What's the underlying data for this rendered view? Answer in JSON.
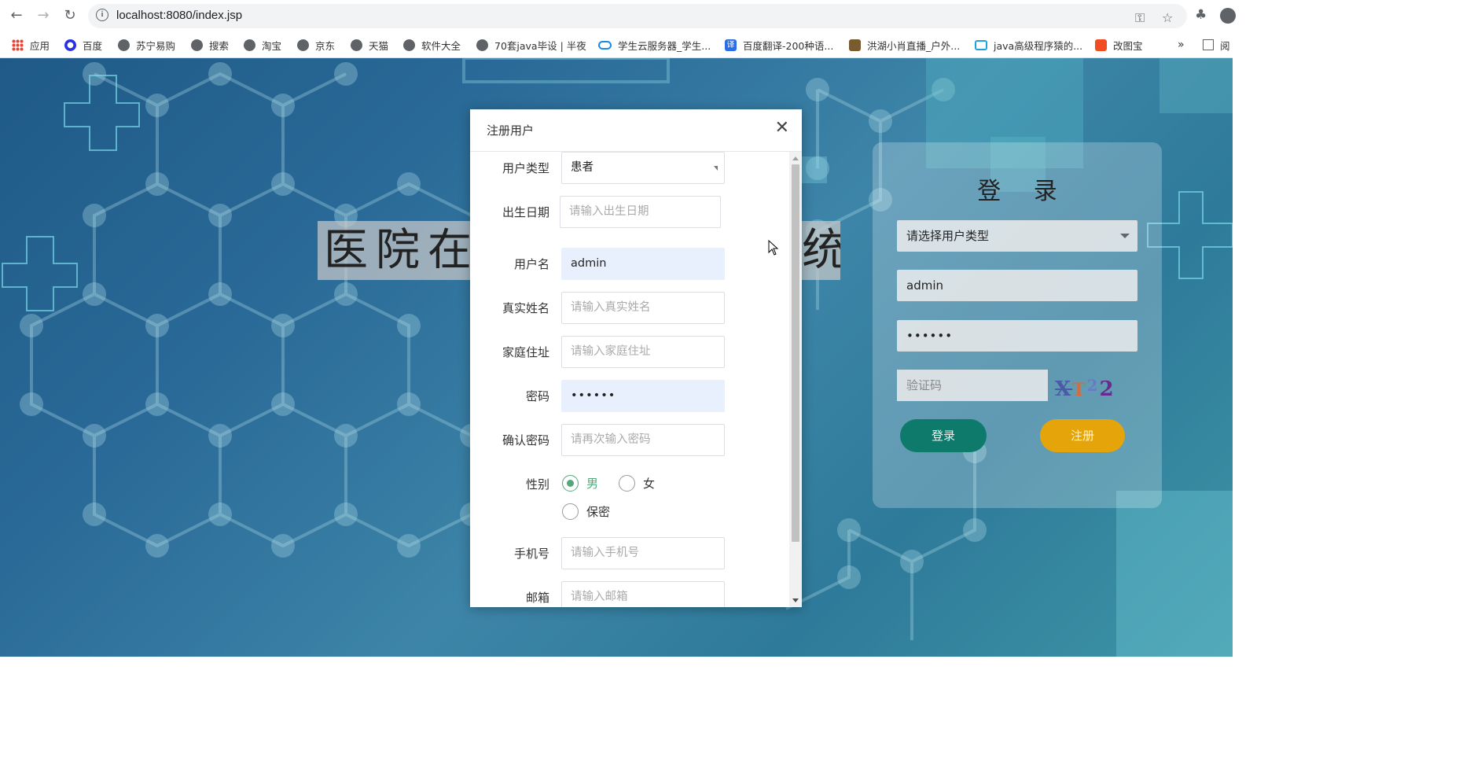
{
  "browser": {
    "url": "localhost:8080/index.jsp",
    "back_icon": "arrow-left-icon",
    "forward_icon": "arrow-right-icon",
    "reload_icon": "reload-icon",
    "bookmarks": [
      {
        "label": "应用",
        "icon": "apps-grid-icon"
      },
      {
        "label": "百度",
        "icon": "baidu-paw-icon"
      },
      {
        "label": "苏宁易购",
        "icon": "globe-icon"
      },
      {
        "label": "搜索",
        "icon": "globe-icon"
      },
      {
        "label": "淘宝",
        "icon": "globe-icon"
      },
      {
        "label": "京东",
        "icon": "globe-icon"
      },
      {
        "label": "天猫",
        "icon": "globe-icon"
      },
      {
        "label": "软件大全",
        "icon": "globe-icon"
      },
      {
        "label": "70套java毕设 | 半夜",
        "icon": "globe-icon"
      },
      {
        "label": "学生云服务器_学生...",
        "icon": "cloud-icon"
      },
      {
        "label": "百度翻译-200种语...",
        "icon": "translate-icon"
      },
      {
        "label": "洪湖小肖直播_户外...",
        "icon": "feather-icon"
      },
      {
        "label": "java高级程序猿的...",
        "icon": "bilibili-icon"
      },
      {
        "label": "改图宝",
        "icon": "gaitubao-icon"
      }
    ],
    "overflow_label": "»",
    "reading_list_label": "阅"
  },
  "page": {
    "title": "医院在线挂号系统",
    "title_visible_left": "医院在",
    "title_visible_right": "统"
  },
  "login": {
    "title": "登 录",
    "user_type_placeholder": "请选择用户类型",
    "username_value": "admin",
    "password_value": "••••••",
    "captcha_placeholder": "验证码",
    "captcha_text": [
      "X",
      "T",
      "2",
      "2"
    ],
    "login_label": "登录",
    "register_label": "注册",
    "colors": {
      "login_button": "#0d7a6b",
      "register_button": "#e4a40a"
    }
  },
  "modal": {
    "title": "注册用户",
    "close_icon": "close-icon",
    "fields": {
      "user_type": {
        "label": "用户类型",
        "value": "患者"
      },
      "birthdate": {
        "label": "出生日期",
        "placeholder": "请输入出生日期"
      },
      "username": {
        "label": "用户名",
        "value": "admin"
      },
      "real_name": {
        "label": "真实姓名",
        "placeholder": "请输入真实姓名"
      },
      "address": {
        "label": "家庭住址",
        "placeholder": "请输入家庭住址"
      },
      "password": {
        "label": "密码",
        "value": "••••••"
      },
      "confirm_password": {
        "label": "确认密码",
        "placeholder": "请再次输入密码"
      },
      "gender": {
        "label": "性别",
        "options": [
          "男",
          "女",
          "保密"
        ],
        "selected": "男"
      },
      "phone": {
        "label": "手机号",
        "placeholder": "请输入手机号"
      },
      "email": {
        "label": "邮箱",
        "placeholder": "请输入邮箱"
      }
    },
    "colors": {
      "radio_selected": "#52a878",
      "autofill_bg": "#e8f0fe"
    }
  }
}
